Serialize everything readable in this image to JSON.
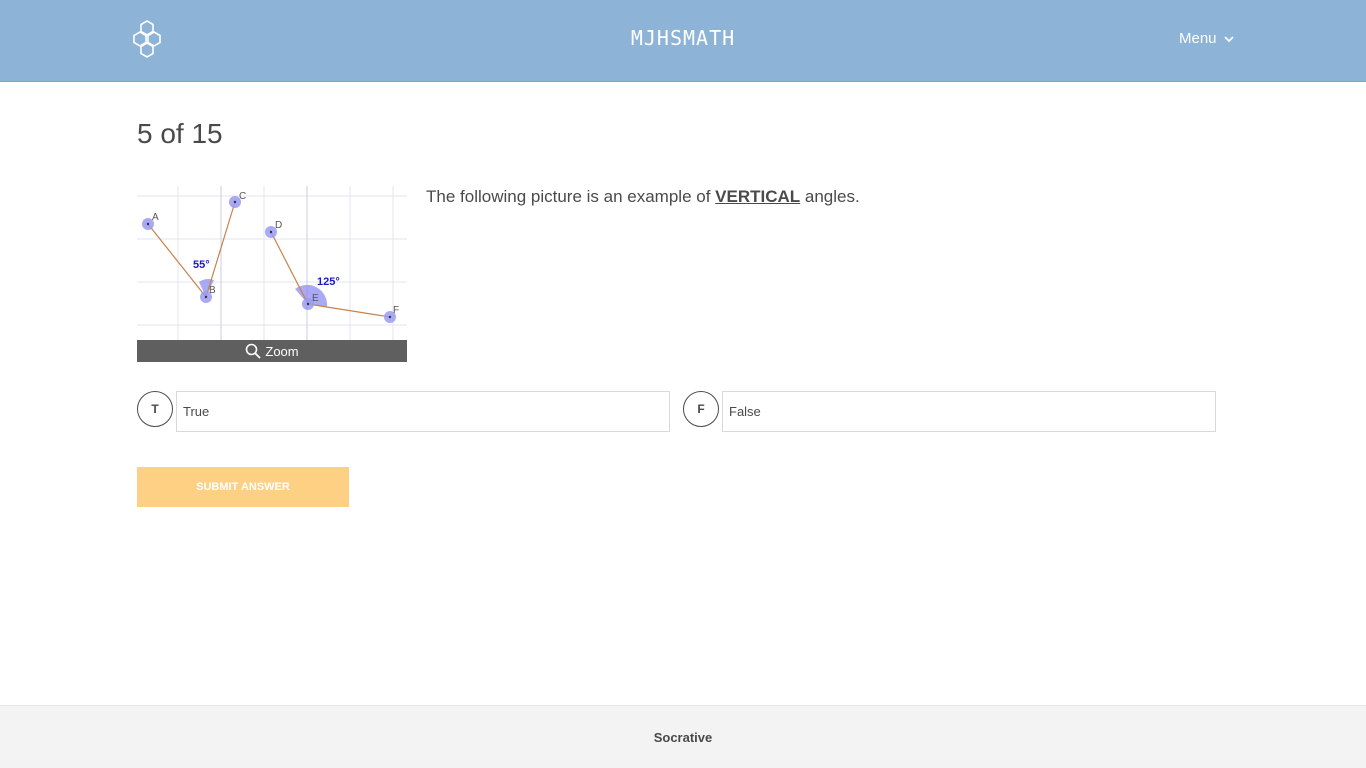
{
  "header": {
    "logo_icon": "hexagon-cluster-icon",
    "room_name": "MJHSMATH",
    "menu_label": "Menu",
    "menu_icon": "chevron-down-icon"
  },
  "question": {
    "progress": "5 of 15",
    "text_before": "The following picture is an example of ",
    "text_emphasis": "VERTICAL",
    "text_after": " angles.",
    "image": {
      "labels": [
        "A",
        "B",
        "C",
        "D",
        "E",
        "F"
      ],
      "angle_1": "55°",
      "angle_2": "125°"
    },
    "zoom_label": "Zoom",
    "zoom_icon": "search-icon"
  },
  "answers": [
    {
      "letter": "T",
      "text": "True"
    },
    {
      "letter": "F",
      "text": "False"
    }
  ],
  "submit_label": "Submit Answer",
  "footer": {
    "brand": "Socrative"
  },
  "colors": {
    "header_bg": "#8db3d6",
    "submit_bg": "#fdd083",
    "footer_bg": "#f3f3f3",
    "angle_fill": "#8c8cf0",
    "angle_text": "#1a1acc",
    "segment": "#c8824a"
  }
}
